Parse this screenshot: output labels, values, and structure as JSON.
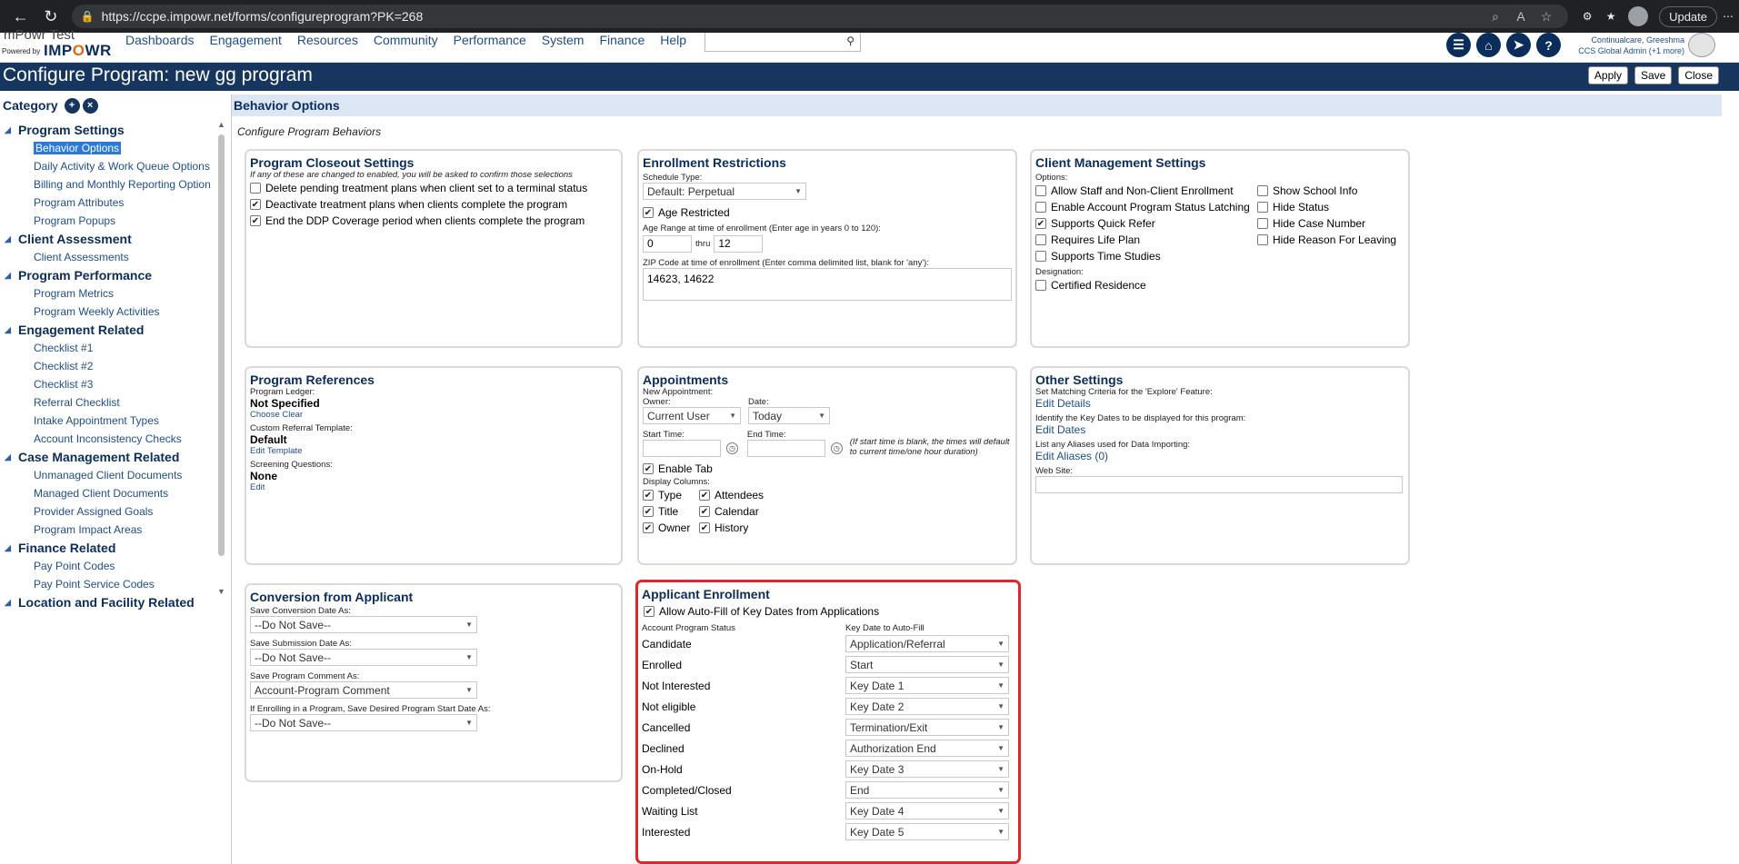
{
  "browser": {
    "url": "https://ccpe.impowr.net/forms/configureprogram?PK=268",
    "update_label": "Update"
  },
  "header": {
    "logo_top": "mPowr Test",
    "logo_powered": "Powered by",
    "logo_main_a": "IMP",
    "logo_main_o": "O",
    "logo_main_b": "WR",
    "menu": [
      "Dashboards",
      "Engagement",
      "Resources",
      "Community",
      "Performance",
      "System",
      "Finance",
      "Help"
    ],
    "user_line1": "Continualcare, Greeshma",
    "user_line2": "CCS Global Admin (+1 more)"
  },
  "title_bar": {
    "title": "Configure Program: new gg program",
    "apply": "Apply",
    "save": "Save",
    "close": "Close"
  },
  "sidebar": {
    "heading": "Category",
    "groups": [
      {
        "label": "Program Settings",
        "items": [
          "Behavior Options",
          "Daily Activity & Work Queue Options",
          "Billing and Monthly Reporting Option",
          "Program Attributes",
          "Program Popups"
        ]
      },
      {
        "label": "Client Assessment",
        "items": [
          "Client Assessments"
        ]
      },
      {
        "label": "Program Performance",
        "items": [
          "Program Metrics",
          "Program Weekly Activities"
        ]
      },
      {
        "label": "Engagement Related",
        "items": [
          "Checklist #1",
          "Checklist #2",
          "Checklist #3",
          "Referral Checklist",
          "Intake Appointment Types",
          "Account Inconsistency Checks"
        ]
      },
      {
        "label": "Case Management Related",
        "items": [
          "Unmanaged Client Documents",
          "Managed Client Documents",
          "Provider Assigned Goals",
          "Program Impact Areas"
        ]
      },
      {
        "label": "Finance Related",
        "items": [
          "Pay Point Codes",
          "Pay Point Service Codes"
        ]
      },
      {
        "label": "Location and Facility Related",
        "items": []
      }
    ]
  },
  "content": {
    "section_title": "Behavior Options",
    "section_sub": "Configure Program Behaviors",
    "closeout": {
      "title": "Program Closeout Settings",
      "note": "If any of these are changed to enabled, you will be asked to confirm those selections",
      "opts": [
        "Delete pending treatment plans when client set to a terminal status",
        "Deactivate treatment plans when clients complete the program",
        "End the DDP Coverage period when clients complete the program"
      ]
    },
    "enroll": {
      "title": "Enrollment Restrictions",
      "schedule_label": "Schedule Type:",
      "schedule_value": "Default: Perpetual",
      "age_restricted": "Age Restricted",
      "age_range_label": "Age Range at time of enrollment (Enter age in years 0 to 120):",
      "age_from": "0",
      "thru": "thru",
      "age_to": "12",
      "zip_label": "ZIP Code at time of enrollment (Enter comma delimited list, blank for 'any'):",
      "zip_value": "14623, 14622"
    },
    "client_mgmt": {
      "title": "Client Management Settings",
      "options_label": "Options:",
      "left_opts": [
        "Allow Staff and Non-Client Enrollment",
        "Enable Account Program Status Latching",
        "Supports Quick Refer",
        "Requires Life Plan",
        "Supports Time Studies"
      ],
      "right_opts": [
        "Show School Info",
        "Hide Status",
        "Hide Case Number",
        "Hide Reason For Leaving"
      ],
      "designation_label": "Designation:",
      "designation_opt": "Certified Residence"
    },
    "references": {
      "title": "Program References",
      "ledger_label": "Program Ledger:",
      "ledger_value": "Not Specified",
      "choose": "Choose",
      "clear": "Clear",
      "referral_label": "Custom Referral Template:",
      "referral_value": "Default",
      "edit_template": "Edit Template",
      "screening_label": "Screening Questions:",
      "screening_value": "None",
      "edit": "Edit"
    },
    "appointments": {
      "title": "Appointments",
      "new_label": "New Appointment:",
      "owner_label": "Owner:",
      "owner_value": "Current User",
      "date_label": "Date:",
      "date_value": "Today",
      "start_label": "Start Time:",
      "end_label": "End Time:",
      "time_note": "(If start time is blank, the times will default to current time/one hour duration)",
      "enable_tab": "Enable Tab",
      "display_label": "Display Columns:",
      "cols_left": [
        "Type",
        "Title",
        "Owner"
      ],
      "cols_right": [
        "Attendees",
        "Calendar",
        "History"
      ]
    },
    "other": {
      "title": "Other Settings",
      "match_label": "Set Matching Criteria for the 'Explore' Feature:",
      "match_link": "Edit Details",
      "dates_label": "Identify the Key Dates to be displayed for this program:",
      "dates_link": "Edit Dates",
      "alias_label": "List any Aliases used for Data Importing:",
      "alias_link": "Edit Aliases (0)",
      "web_label": "Web Site:"
    },
    "conversion": {
      "title": "Conversion from Applicant",
      "fields": [
        {
          "label": "Save Conversion Date As:",
          "value": "--Do Not Save--"
        },
        {
          "label": "Save Submission Date As:",
          "value": "--Do Not Save--"
        },
        {
          "label": "Save Program Comment As:",
          "value": "Account-Program Comment"
        },
        {
          "label": "If Enrolling in a Program, Save Desired Program Start Date As:",
          "value": "--Do Not Save--"
        }
      ]
    },
    "applicant": {
      "title": "Applicant Enrollment",
      "allow": "Allow Auto-Fill of Key Dates from Applications",
      "col1": "Account Program Status",
      "col2": "Key Date to Auto-Fill",
      "rows": [
        {
          "status": "Candidate",
          "date": "Application/Referral"
        },
        {
          "status": "Enrolled",
          "date": "Start"
        },
        {
          "status": "Not Interested",
          "date": "Key Date 1"
        },
        {
          "status": "Not eligible",
          "date": "Key Date 2"
        },
        {
          "status": "Cancelled",
          "date": "Termination/Exit"
        },
        {
          "status": "Declined",
          "date": "Authorization End"
        },
        {
          "status": "On-Hold",
          "date": "Key Date 3"
        },
        {
          "status": "Completed/Closed",
          "date": "End"
        },
        {
          "status": "Waiting List",
          "date": "Key Date 4"
        },
        {
          "status": "Interested",
          "date": "Key Date 5"
        }
      ]
    }
  }
}
